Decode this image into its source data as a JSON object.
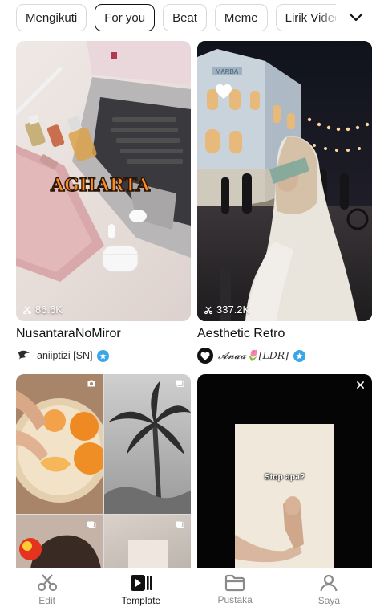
{
  "categories": [
    {
      "label": "Mengikuti",
      "active": false
    },
    {
      "label": "For you",
      "active": true
    },
    {
      "label": "Beat",
      "active": false
    },
    {
      "label": "Meme",
      "active": false
    },
    {
      "label": "Lirik Video",
      "active": false
    }
  ],
  "templates": [
    {
      "title": "NusantaraNoMiror",
      "usage": "86.6K",
      "author": "aniiptizi [SN]",
      "verified": true,
      "sticker_text": "AGHARTA"
    },
    {
      "title": "Aesthetic Retro",
      "usage": "337.2K",
      "author": "𝓐𝓷𝓪𝓪🌷[LDR]",
      "verified": true,
      "sign_text": "MARBA"
    },
    {
      "title": "",
      "usage": ""
    },
    {
      "title": "",
      "usage": "",
      "caption": "Stop apa?"
    }
  ],
  "nav": [
    {
      "label": "Edit",
      "icon": "scissors-icon",
      "active": false
    },
    {
      "label": "Template",
      "icon": "template-icon",
      "active": true
    },
    {
      "label": "Pustaka",
      "icon": "folder-icon",
      "active": false
    },
    {
      "label": "Saya",
      "icon": "profile-icon",
      "active": false
    }
  ],
  "colors": {
    "verified": "#3aa6e8",
    "active_text": "#111111",
    "inactive_text": "#8a8a8a"
  }
}
